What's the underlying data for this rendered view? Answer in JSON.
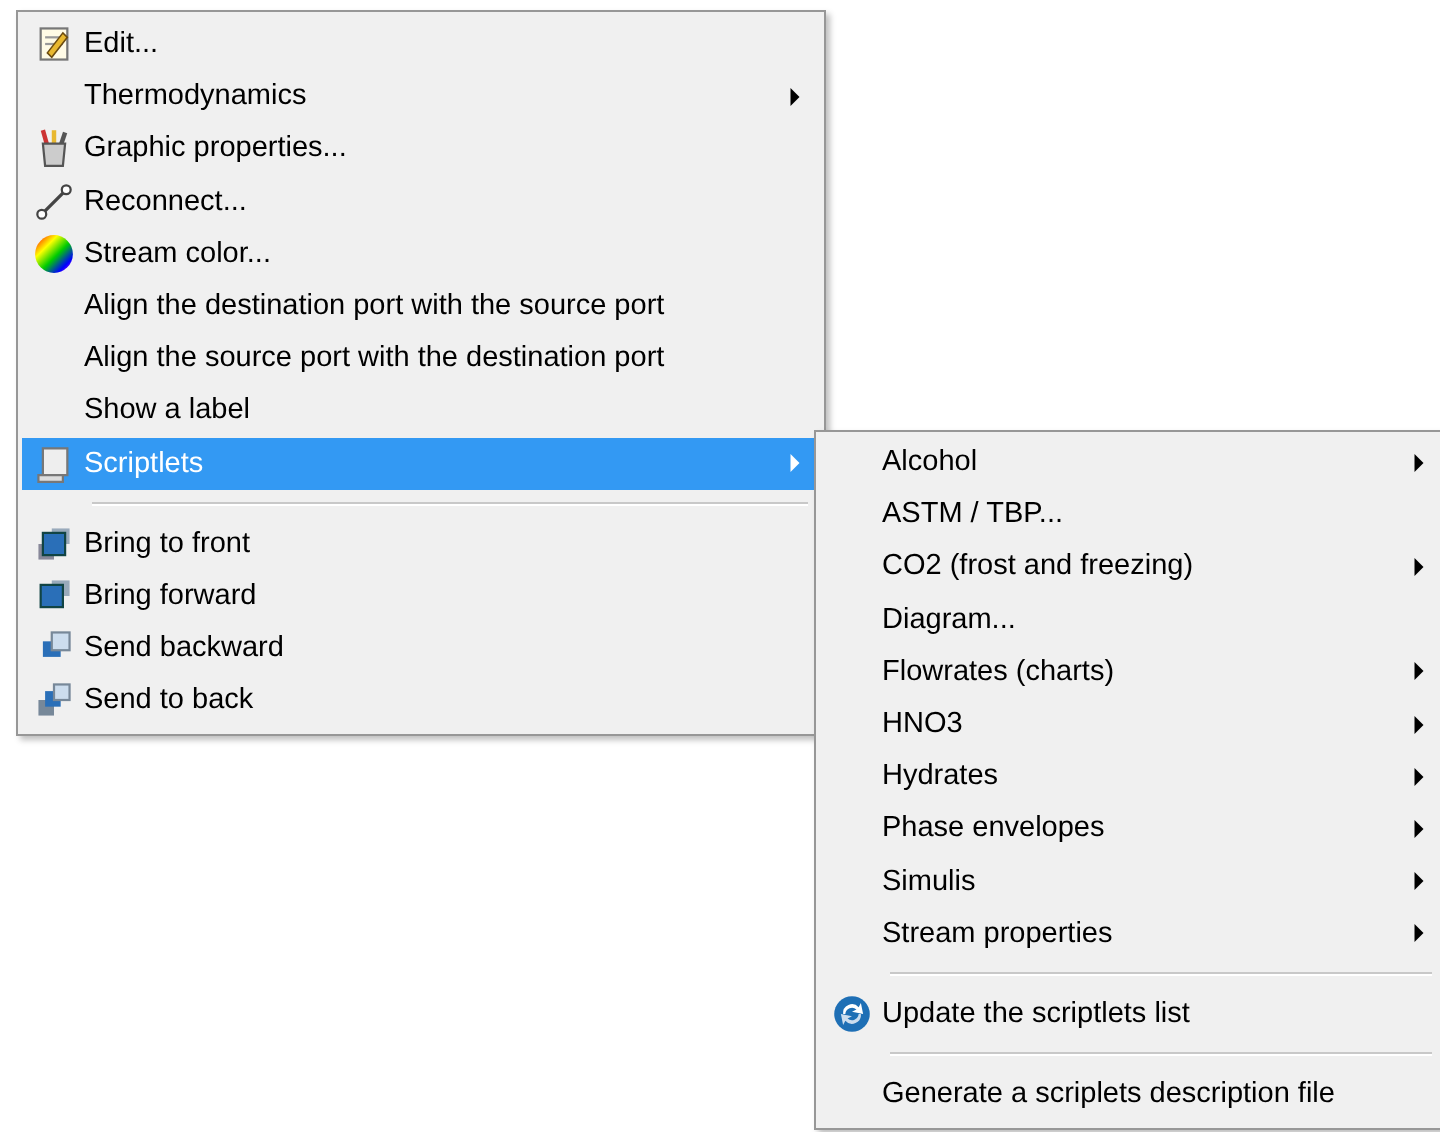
{
  "context_menu": {
    "items": [
      {
        "kind": "item",
        "label": "Edit...",
        "submenu": false,
        "selected": false
      },
      {
        "kind": "item",
        "label": "Thermodynamics",
        "submenu": true,
        "selected": false
      },
      {
        "kind": "item",
        "label": "Graphic properties...",
        "submenu": false,
        "selected": false
      },
      {
        "kind": "item",
        "label": "Reconnect...",
        "submenu": false,
        "selected": false
      },
      {
        "kind": "item",
        "label": "Stream color...",
        "submenu": false,
        "selected": false
      },
      {
        "kind": "item",
        "label": "Align the destination port with the source port",
        "submenu": false,
        "selected": false
      },
      {
        "kind": "item",
        "label": "Align the source port with the destination port",
        "submenu": false,
        "selected": false
      },
      {
        "kind": "item",
        "label": "Show a label",
        "submenu": false,
        "selected": false
      },
      {
        "kind": "item",
        "label": "Scriptlets",
        "submenu": true,
        "selected": true
      },
      {
        "kind": "separator"
      },
      {
        "kind": "item",
        "label": "Bring to front",
        "submenu": false,
        "selected": false
      },
      {
        "kind": "item",
        "label": "Bring forward",
        "submenu": false,
        "selected": false
      },
      {
        "kind": "item",
        "label": "Send backward",
        "submenu": false,
        "selected": false
      },
      {
        "kind": "item",
        "label": "Send to back",
        "submenu": false,
        "selected": false
      }
    ]
  },
  "submenu": {
    "items": [
      {
        "kind": "item",
        "label": "Alcohol",
        "submenu": true,
        "selected": false
      },
      {
        "kind": "item",
        "label": "ASTM / TBP...",
        "submenu": false,
        "selected": false
      },
      {
        "kind": "item",
        "label": "CO2 (frost and freezing)",
        "submenu": true,
        "selected": false
      },
      {
        "kind": "item",
        "label": "Diagram...",
        "submenu": false,
        "selected": false
      },
      {
        "kind": "item",
        "label": "Flowrates (charts)",
        "submenu": true,
        "selected": false
      },
      {
        "kind": "item",
        "label": "HNO3",
        "submenu": true,
        "selected": false
      },
      {
        "kind": "item",
        "label": "Hydrates",
        "submenu": true,
        "selected": false
      },
      {
        "kind": "item",
        "label": "Phase envelopes",
        "submenu": true,
        "selected": false
      },
      {
        "kind": "item",
        "label": "Simulis",
        "submenu": true,
        "selected": false
      },
      {
        "kind": "item",
        "label": "Stream properties",
        "submenu": true,
        "selected": false
      },
      {
        "kind": "separator"
      },
      {
        "kind": "item",
        "label": "Update the scriptlets list",
        "submenu": false,
        "selected": false
      },
      {
        "kind": "separator"
      },
      {
        "kind": "item",
        "label": "Generate a scriplets description file",
        "submenu": false,
        "selected": false
      }
    ]
  }
}
